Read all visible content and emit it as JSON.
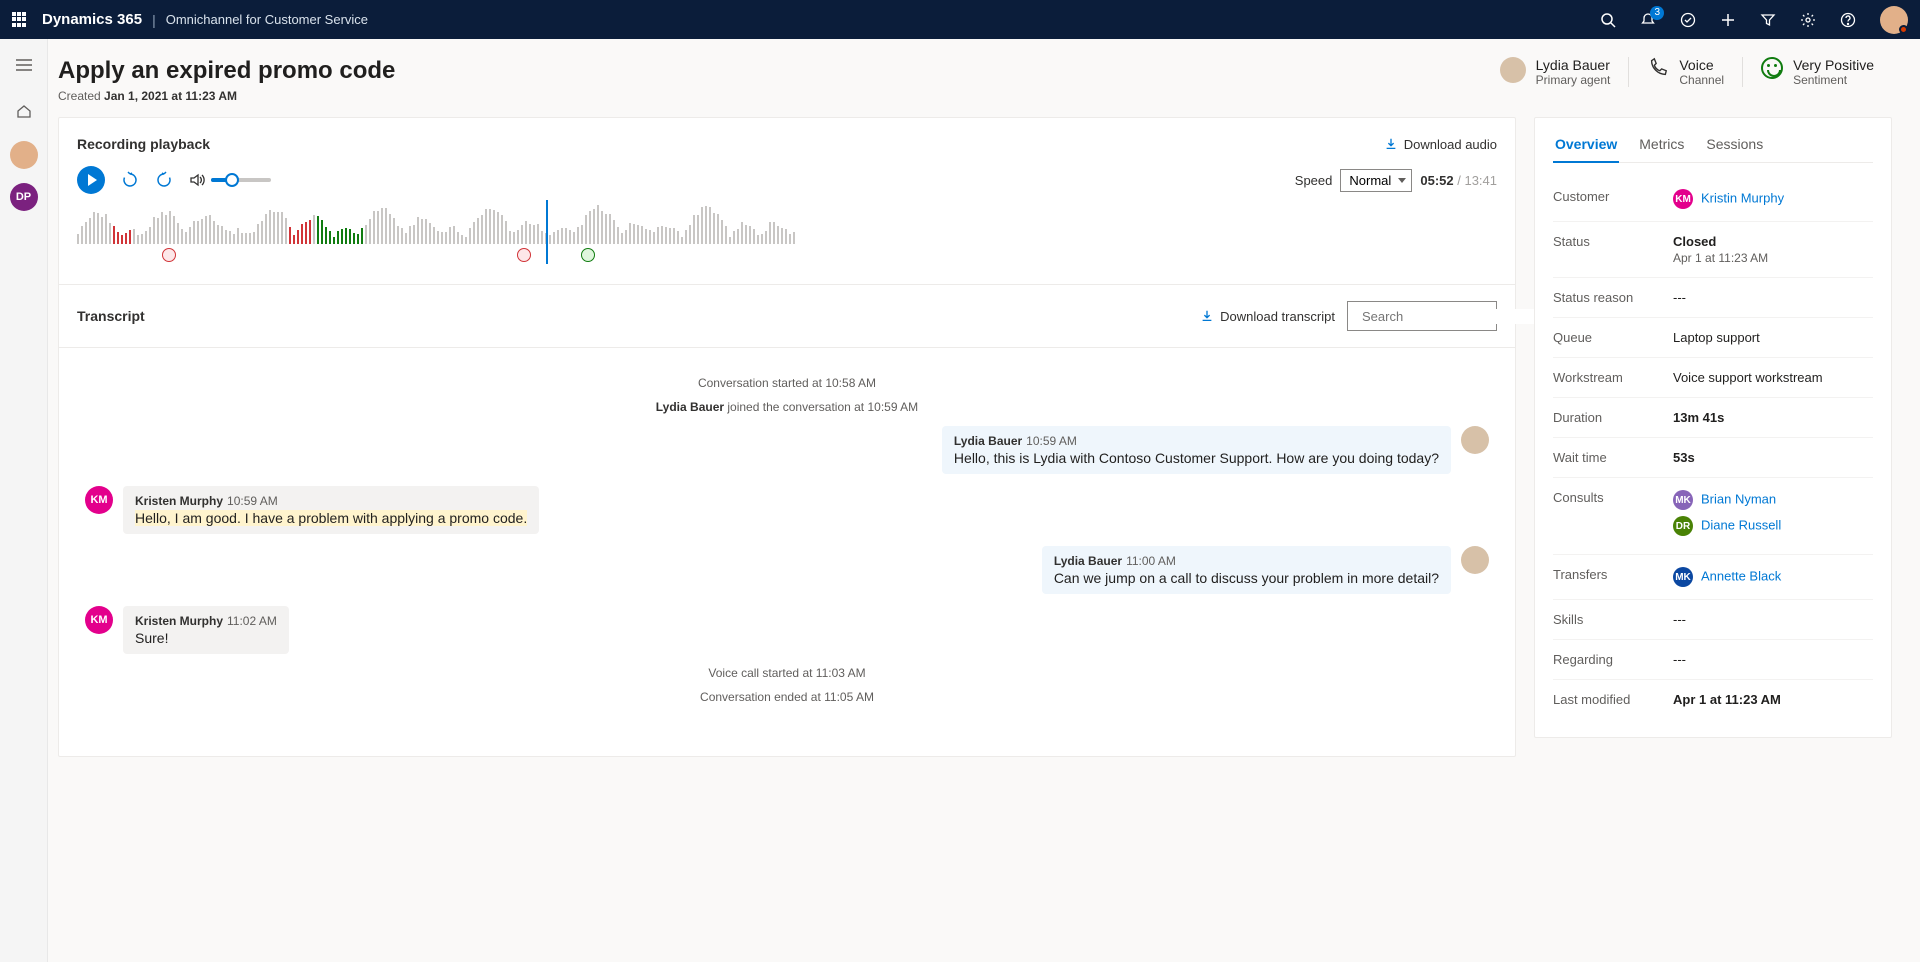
{
  "topbar": {
    "brand": "Dynamics 365",
    "app": "Omnichannel for Customer Service",
    "notification_count": "3"
  },
  "rail": {
    "pill": "DP"
  },
  "header": {
    "title": "Apply an expired promo code",
    "created_prefix": "Created ",
    "created_value": "Jan 1, 2021 at 11:23 AM",
    "agent_name": "Lydia Bauer",
    "agent_role": "Primary agent",
    "channel_value": "Voice",
    "channel_label": "Channel",
    "sentiment_value": "Very Positive",
    "sentiment_label": "Sentiment"
  },
  "playback": {
    "title": "Recording playback",
    "download": "Download audio",
    "speed_label": "Speed",
    "speed_value": "Normal",
    "time_current": "05:52",
    "time_total": " / 13:41"
  },
  "transcript": {
    "title": "Transcript",
    "download": "Download transcript",
    "search_placeholder": "Search",
    "sys1": "Conversation started at 10:58 AM",
    "sys2_name": "Lydia Bauer",
    "sys2_rest": " joined the conversation at 10:59 AM",
    "m1_name": "Lydia Bauer",
    "m1_time": "10:59 AM",
    "m1_text": "Hello, this is Lydia with Contoso Customer Support. How are you doing today?",
    "m2_name": "Kristen Murphy",
    "m2_time": "10:59 AM",
    "m2_text": "Hello, I am good. I have a problem with applying a promo code.",
    "m3_name": "Lydia Bauer",
    "m3_time": "11:00 AM",
    "m3_text": "Can we jump on a call to discuss your problem in more detail?",
    "m4_name": "Kristen Murphy",
    "m4_time": "11:02 AM",
    "m4_text": "Sure!",
    "sys3": "Voice call started at 11:03 AM",
    "sys4": "Conversation ended at 11:05 AM",
    "km_initials": "KM"
  },
  "overview": {
    "tabs": {
      "overview": "Overview",
      "metrics": "Metrics",
      "sessions": "Sessions"
    },
    "customer_label": "Customer",
    "customer_initials": "KM",
    "customer_name": "Kristin Murphy",
    "status_label": "Status",
    "status_value": "Closed",
    "status_sub": "Apr 1 at 11:23 AM",
    "reason_label": "Status reason",
    "reason_value": "---",
    "queue_label": "Queue",
    "queue_value": "Laptop support",
    "workstream_label": "Workstream",
    "workstream_value": "Voice support workstream",
    "duration_label": "Duration",
    "duration_value": "13m 41s",
    "wait_label": "Wait time",
    "wait_value": "53s",
    "consults_label": "Consults",
    "consult1_initials": "MK",
    "consult1_name": "Brian Nyman",
    "consult2_initials": "DR",
    "consult2_name": "Diane Russell",
    "transfers_label": "Transfers",
    "transfer1_initials": "MK",
    "transfer1_name": "Annette Black",
    "skills_label": "Skills",
    "skills_value": "---",
    "regarding_label": "Regarding",
    "regarding_value": "---",
    "modified_label": "Last modified",
    "modified_value": "Apr 1 at 11:23 AM"
  }
}
